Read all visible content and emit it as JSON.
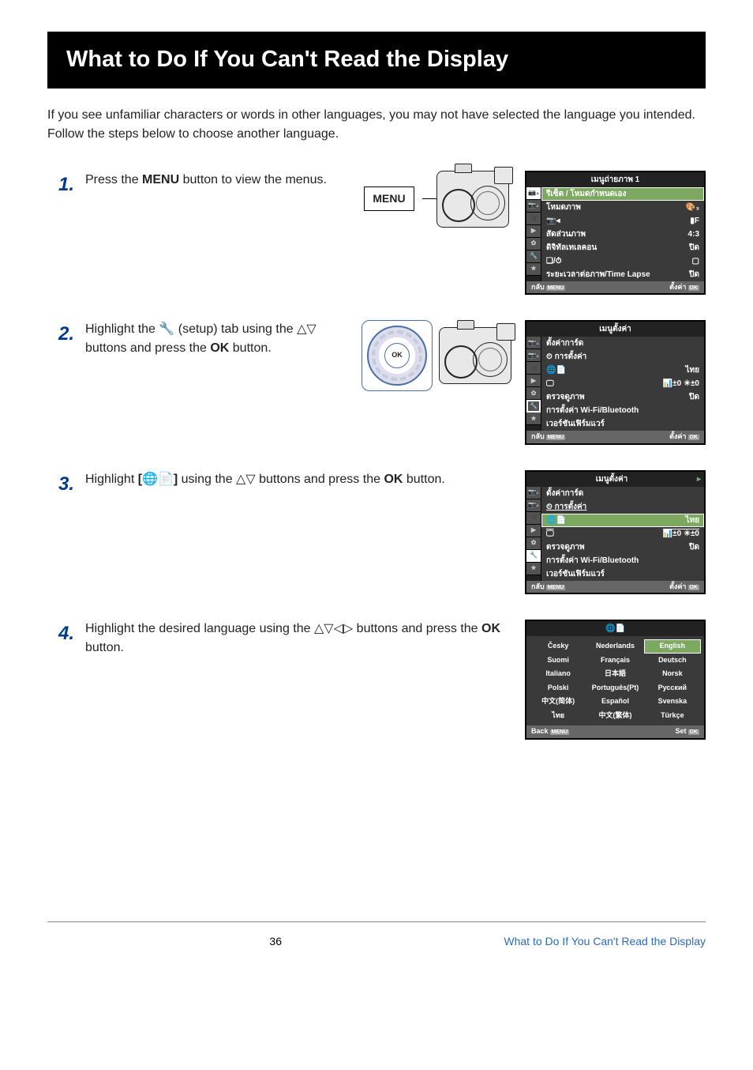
{
  "title": "What to Do If You Can't Read the Display",
  "intro": "If you see unfamiliar characters or words in other languages, you may not have selected the language you intended. Follow the steps below to choose another language.",
  "steps": {
    "s1": {
      "n": "1.",
      "text_a": "Press the ",
      "bold": "MENU",
      "text_b": " button to view the menus.",
      "menu_label": "MENU"
    },
    "s2": {
      "n": "2.",
      "text_a": "Highlight the ",
      "icon_name": "wrench-icon",
      "text_b": " (setup) tab using the ",
      "buttons_text": " buttons and press the ",
      "bold": "OK",
      "text_c": " button.",
      "ok_label": "OK"
    },
    "s3": {
      "n": "3.",
      "text_a": "Highlight ",
      "bracket": "[🌐📄]",
      "text_b": " using the ",
      "buttons_text": " buttons and press the ",
      "bold": "OK",
      "text_c": " button."
    },
    "s4": {
      "n": "4.",
      "text_a": "Highlight the desired language using the ",
      "buttons_text": " buttons and press the ",
      "bold": "OK",
      "text_c": " button."
    }
  },
  "screen1": {
    "title": "เมนูถ่ายภาพ 1",
    "rows": [
      {
        "l": "รีเซ็ต / โหมดกำหนดเอง",
        "r": ""
      },
      {
        "l": "โหมดภาพ",
        "r": "🎨₃"
      },
      {
        "l": "📷◂",
        "r": "▮F"
      },
      {
        "l": "สัดส่วนภาพ",
        "r": "4:3"
      },
      {
        "l": "ดิจิทัลเทเลคอน",
        "r": "ปิด"
      },
      {
        "l": "❏/⏱",
        "r": "▢"
      },
      {
        "l": "ระยะเวลาต่อภาพ/Time Lapse",
        "r": "ปิด"
      }
    ],
    "footer_l": "กลับ",
    "footer_l_btn": "MENU",
    "footer_r": "ตั้งค่า",
    "footer_r_btn": "OK"
  },
  "screen2": {
    "title": "เมนูตั้งค่า",
    "rows": [
      {
        "l": "ตั้งค่าการ์ด",
        "r": ""
      },
      {
        "l": "⏲ การตั้งค่า",
        "r": ""
      },
      {
        "l": "🌐📄",
        "r": "ไทย"
      },
      {
        "l": "🖵",
        "r": "📊±0 ☀±0"
      },
      {
        "l": "ตรวจดูภาพ",
        "r": "ปิด"
      },
      {
        "l": "การตั้งค่า Wi-Fi/Bluetooth",
        "r": ""
      },
      {
        "l": "เวอร์ชันเฟิร์มแวร์",
        "r": ""
      }
    ]
  },
  "screen3": {
    "title": "เมนูตั้งค่า"
  },
  "screen4": {
    "title": "🌐📄",
    "langs": [
      "Česky",
      "Nederlands",
      "English",
      "Suomi",
      "Français",
      "Deutsch",
      "Italiano",
      "日本語",
      "Norsk",
      "Polski",
      "Português(Pt)",
      "Русский",
      "中文(简体)",
      "Español",
      "Svenska",
      "ไทย",
      "中文(繁体)",
      "Türkçe"
    ],
    "footer_l": "Back",
    "footer_l_btn": "MENU",
    "footer_r": "Set",
    "footer_r_btn": "OK"
  },
  "footer": {
    "page": "36",
    "link": "What to Do If You Can't Read the Display"
  },
  "symbols": {
    "up": "△",
    "down": "▽",
    "left": "◁",
    "right": "▷",
    "wrench": "🔧"
  }
}
